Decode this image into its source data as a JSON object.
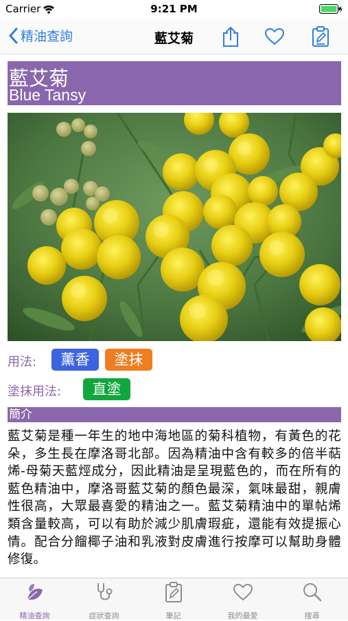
{
  "status_bar": {
    "carrier": "Carrier",
    "time": "9:21 PM"
  },
  "nav": {
    "back_label": "精油查詢",
    "title": "藍艾菊"
  },
  "header": {
    "name_zh": "藍艾菊",
    "name_en": "Blue Tansy"
  },
  "usage": {
    "label": "用法:",
    "tags": [
      {
        "text": "薰香",
        "color": "#3d64e0"
      },
      {
        "text": "塗抹",
        "color": "#ef7d22"
      }
    ]
  },
  "topical": {
    "label": "塗抹用法:",
    "tags": [
      {
        "text": "直塗",
        "color": "#12a63e"
      }
    ]
  },
  "intro": {
    "heading": "簡介",
    "text": "藍艾菊是種一年生的地中海地區的菊科植物，有黃色的花朵，多生長在摩洛哥北部。因為精油中含有較多的倍半萜烯-母菊天藍烴成分，因此精油是呈現藍色的，而在所有的藍色精油中，摩洛哥藍艾菊的顏色最深，氣味最甜，親膚性很高，大眾最喜愛的精油之一。藍艾菊精油中的單帖烯類含量較高，可以有助於減少肌膚瑕疵，還能有效提振心情。配合分餾椰子油和乳液對皮膚進行按摩可以幫助身體修復。"
  },
  "tabs": [
    {
      "label": "精油查詢",
      "icon": "leaf-icon",
      "active": true
    },
    {
      "label": "症狀查詢",
      "icon": "stethoscope-icon",
      "active": false
    },
    {
      "label": "筆記",
      "icon": "notepad-icon",
      "active": false
    },
    {
      "label": "我的最愛",
      "icon": "heart-icon",
      "active": false
    },
    {
      "label": "搜尋",
      "icon": "search-icon",
      "active": false
    }
  ],
  "colors": {
    "accent": "#8a67ad",
    "link": "#2f7de1"
  }
}
